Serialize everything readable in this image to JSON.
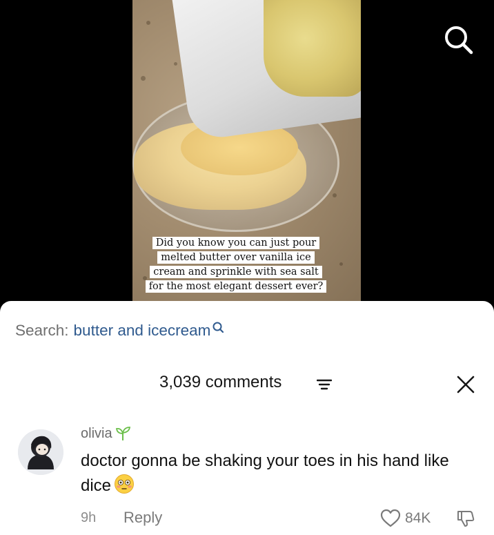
{
  "video": {
    "caption_lines": [
      "Did you know you can just pour",
      "melted butter over vanilla ice",
      "cream and sprinkle with sea salt",
      "for the most elegant dessert ever?"
    ]
  },
  "top_bar": {
    "search_icon": "search-icon"
  },
  "search": {
    "label": "Search:",
    "query": "butter and icecream",
    "icon": "search-icon"
  },
  "comments": {
    "count_label": "3,039 comments",
    "filter_icon": "filter-icon",
    "close_icon": "close-icon",
    "items": [
      {
        "username": "olivia",
        "badge_icon": "sprout-icon",
        "text": "doctor gonna be shaking your toes in his hand like dice",
        "emoji": "flushed-face-emoji",
        "time": "9h",
        "reply_label": "Reply",
        "likes": "84K",
        "like_icon": "heart-icon",
        "dislike_icon": "thumbs-down-icon"
      }
    ]
  },
  "colors": {
    "background": "#000000",
    "sheet": "#ffffff",
    "query_link": "#2f5a8e",
    "muted": "#7a7a7a"
  }
}
